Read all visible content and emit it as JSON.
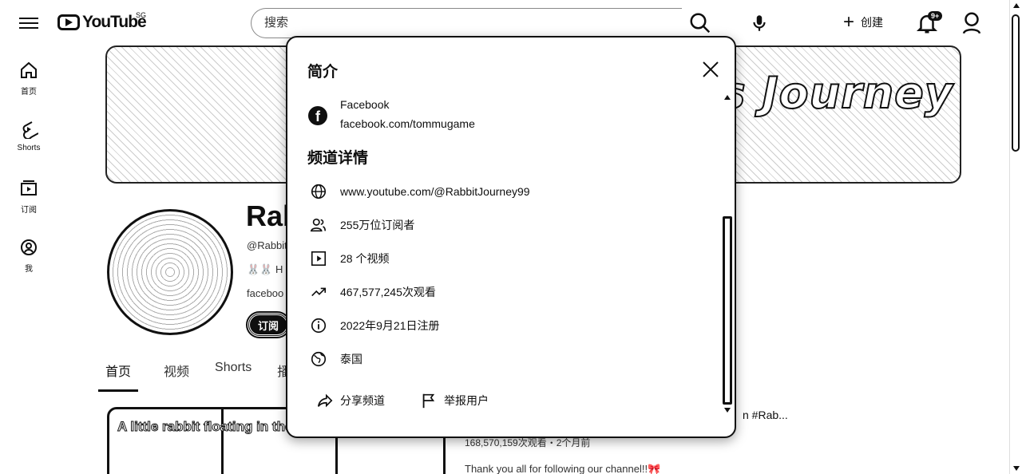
{
  "header": {
    "logo_text": "YouTube",
    "region": "SG",
    "search_placeholder": "搜索",
    "create_label": "创建",
    "notification_badge": "9+"
  },
  "leftnav": {
    "items": [
      {
        "label": "首页",
        "icon": "home-icon"
      },
      {
        "label": "Shorts",
        "icon": "shorts-icon"
      },
      {
        "label": "订阅",
        "icon": "subscriptions-icon"
      },
      {
        "label": "我",
        "icon": "you-icon"
      }
    ]
  },
  "banner": {
    "title": "'s Journey"
  },
  "channel": {
    "name": "Rab",
    "handle": "@Rabbit",
    "desc": "🐰🐰 H",
    "link": "faceboo",
    "subscribe_label": "订阅"
  },
  "tabs": [
    {
      "label": "首页"
    },
    {
      "label": "视频"
    },
    {
      "label": "Shorts"
    },
    {
      "label": "播"
    }
  ],
  "video": {
    "thumb_text": "A little rabbit floating in the",
    "title_tail": "n #Rab...",
    "meta": "168,570,159次观看・2个月前",
    "desc": "Thank you all for following our channel!!🎀"
  },
  "about": {
    "title": "简介",
    "link_label": "Facebook",
    "link_url": "facebook.com/tommugame",
    "details_title": "频道详情",
    "details": [
      {
        "icon": "globe-icon",
        "text": "www.youtube.com/@RabbitJourney99"
      },
      {
        "icon": "subscribers-icon",
        "text": "255万位订阅者"
      },
      {
        "icon": "video-icon",
        "text": "28 个视频"
      },
      {
        "icon": "trending-icon",
        "text": "467,577,245次观看"
      },
      {
        "icon": "info-icon",
        "text": "2022年9月21日注册"
      },
      {
        "icon": "location-icon",
        "text": "泰国"
      }
    ],
    "share_label": "分享频道",
    "report_label": "举报用户"
  }
}
